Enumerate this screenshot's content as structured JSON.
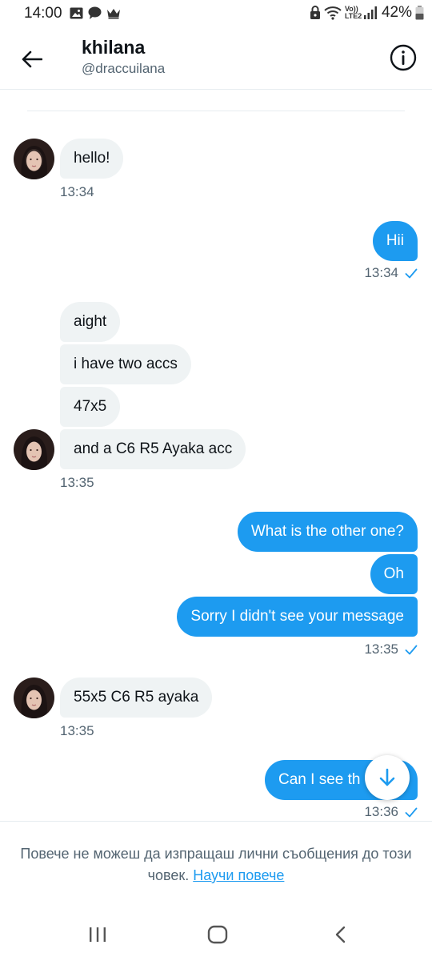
{
  "status_bar": {
    "time": "14:00",
    "network_label": "Vo)) LTE2",
    "battery": "42%",
    "icons_left": [
      "image-icon",
      "chat-bubble-icon",
      "crown-icon"
    ],
    "icons_right": [
      "lock-icon",
      "wifi-icon",
      "signal-icon",
      "battery-icon"
    ]
  },
  "header": {
    "name": "khilana",
    "handle": "@draccuilana",
    "back_icon": "arrow-left-icon",
    "info_icon": "info-icon"
  },
  "messages": [
    {
      "dir": "in",
      "text": "hello!"
    },
    {
      "dir": "in_time",
      "time": "13:34"
    },
    {
      "dir": "out",
      "text": "Hii"
    },
    {
      "dir": "out_time",
      "time": "13:34"
    },
    {
      "dir": "in",
      "text": "aight"
    },
    {
      "dir": "in",
      "text": "i have two accs"
    },
    {
      "dir": "in",
      "text": "47x5"
    },
    {
      "dir": "in",
      "text": "and a C6 R5 Ayaka acc"
    },
    {
      "dir": "in_time",
      "time": "13:35"
    },
    {
      "dir": "out",
      "text": "What is the other one?"
    },
    {
      "dir": "out",
      "text": "Oh"
    },
    {
      "dir": "out",
      "text": "Sorry I didn't see your message"
    },
    {
      "dir": "out_time",
      "time": "13:35"
    },
    {
      "dir": "in",
      "text": "55x5 C6 R5 ayaka"
    },
    {
      "dir": "in_time",
      "time": "13:35"
    },
    {
      "dir": "out",
      "text": "Can I see th"
    },
    {
      "dir": "out_time",
      "time": "13:36"
    }
  ],
  "scroll_button_icon": "arrow-down-icon",
  "notice": {
    "text": "Повече не можеш да изпращаш лични съобщения до този човек.",
    "link": "Научи повече"
  },
  "navbar": {
    "recents_icon": "recents-icon",
    "home_icon": "home-icon",
    "back_icon": "back-chevron-icon"
  },
  "colors": {
    "accent": "#1d9bf0",
    "incoming_bubble": "#eff3f4",
    "secondary_text": "#536471"
  }
}
